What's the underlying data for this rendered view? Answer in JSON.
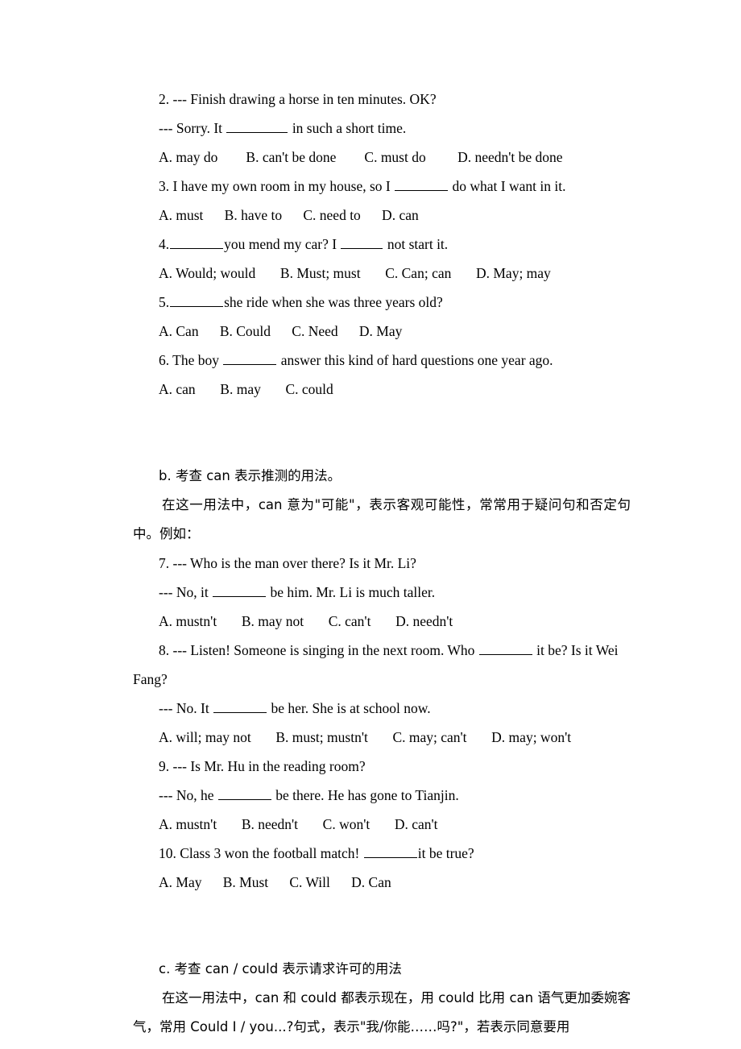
{
  "document": {
    "title": "Modal Verbs Grammar Exercises",
    "blocks": [
      {
        "id": "q2-stem1",
        "kind": "question-stem",
        "indent": true,
        "segments": [
          {
            "type": "text",
            "value": "2. --- Finish drawing a horse in ten minutes. OK?"
          }
        ]
      },
      {
        "id": "q2-stem2",
        "kind": "question-stem",
        "indent": true,
        "segments": [
          {
            "type": "text",
            "value": "--- Sorry. It "
          },
          {
            "type": "blank",
            "width": "w-lg"
          },
          {
            "type": "text",
            "value": " in such a short time."
          }
        ]
      },
      {
        "id": "q2-options",
        "kind": "options",
        "indent": true,
        "segments": [
          {
            "type": "text",
            "value": "A. may do        B. can't be done        C. must do         D. needn't be done"
          }
        ]
      },
      {
        "id": "q3-stem",
        "kind": "question-stem",
        "indent": true,
        "segments": [
          {
            "type": "text",
            "value": "3. I have my own room in my house, so I "
          },
          {
            "type": "blank",
            "width": "w-md"
          },
          {
            "type": "text",
            "value": " do what I want in it."
          }
        ]
      },
      {
        "id": "q3-options",
        "kind": "options",
        "indent": true,
        "segments": [
          {
            "type": "text",
            "value": "A. must      B. have to      C. need to      D. can"
          }
        ]
      },
      {
        "id": "q4-stem",
        "kind": "question-stem",
        "indent": true,
        "segments": [
          {
            "type": "text",
            "value": "4."
          },
          {
            "type": "blank",
            "width": "w-md"
          },
          {
            "type": "text",
            "value": "you mend my car? I "
          },
          {
            "type": "blank",
            "width": "w-sm"
          },
          {
            "type": "text",
            "value": " not start it."
          }
        ]
      },
      {
        "id": "q4-options",
        "kind": "options",
        "indent": true,
        "segments": [
          {
            "type": "text",
            "value": "A. Would; would       B. Must; must       C. Can; can       D. May; may"
          }
        ]
      },
      {
        "id": "q5-stem",
        "kind": "question-stem",
        "indent": true,
        "segments": [
          {
            "type": "text",
            "value": "5."
          },
          {
            "type": "blank",
            "width": "w-md"
          },
          {
            "type": "text",
            "value": "she ride when she was three years old?"
          }
        ]
      },
      {
        "id": "q5-options",
        "kind": "options",
        "indent": true,
        "segments": [
          {
            "type": "text",
            "value": "A. Can      B. Could      C. Need      D. May"
          }
        ]
      },
      {
        "id": "q6-stem",
        "kind": "question-stem",
        "indent": true,
        "segments": [
          {
            "type": "text",
            "value": "6. The boy "
          },
          {
            "type": "blank",
            "width": "w-md"
          },
          {
            "type": "text",
            "value": " answer this kind of hard questions one year ago."
          }
        ]
      },
      {
        "id": "q6-options",
        "kind": "options",
        "indent": true,
        "segments": [
          {
            "type": "text",
            "value": "A. can       B. may       C. could"
          }
        ]
      },
      {
        "id": "gap-1",
        "kind": "spacer"
      },
      {
        "id": "gap-2",
        "kind": "spacer"
      },
      {
        "id": "heading-b",
        "kind": "heading",
        "indent": true,
        "chinese": true,
        "segments": [
          {
            "type": "text",
            "value": "b. 考查 can 表示推测的用法。"
          }
        ]
      },
      {
        "id": "para-b",
        "kind": "paragraph",
        "chinese": true,
        "segments": [
          {
            "type": "text",
            "value": "在这一用法中，can 意为\"可能\"，表示客观可能性，常常用于疑问句和否定句中。例如："
          }
        ]
      },
      {
        "id": "q7-stem1",
        "kind": "question-stem",
        "indent": true,
        "segments": [
          {
            "type": "text",
            "value": "7. --- Who is the man over there? Is it Mr. Li?"
          }
        ]
      },
      {
        "id": "q7-stem2",
        "kind": "question-stem",
        "indent": true,
        "segments": [
          {
            "type": "text",
            "value": "--- No, it "
          },
          {
            "type": "blank",
            "width": "w-md"
          },
          {
            "type": "text",
            "value": " be him. Mr. Li is much taller."
          }
        ]
      },
      {
        "id": "q7-options",
        "kind": "options",
        "indent": true,
        "segments": [
          {
            "type": "text",
            "value": "A. mustn't       B. may not       C. can't       D. needn't"
          }
        ]
      },
      {
        "id": "q8-stem1",
        "kind": "question-stem",
        "indent": true,
        "segments": [
          {
            "type": "text",
            "value": "8. --- Listen! Someone is singing in the next room. Who "
          },
          {
            "type": "blank",
            "width": "w-md"
          },
          {
            "type": "text",
            "value": " it be? Is it Wei Fang?"
          }
        ]
      },
      {
        "id": "q8-stem2",
        "kind": "question-stem",
        "indent": true,
        "segments": [
          {
            "type": "text",
            "value": "--- No. It "
          },
          {
            "type": "blank",
            "width": "w-md"
          },
          {
            "type": "text",
            "value": " be her. She is at school now."
          }
        ]
      },
      {
        "id": "q8-options",
        "kind": "options",
        "indent": true,
        "segments": [
          {
            "type": "text",
            "value": "A. will; may not       B. must; mustn't       C. may; can't       D. may; won't"
          }
        ]
      },
      {
        "id": "q9-stem1",
        "kind": "question-stem",
        "indent": true,
        "segments": [
          {
            "type": "text",
            "value": "9. --- Is Mr. Hu in the reading room?"
          }
        ]
      },
      {
        "id": "q9-stem2",
        "kind": "question-stem",
        "indent": true,
        "segments": [
          {
            "type": "text",
            "value": "--- No, he "
          },
          {
            "type": "blank",
            "width": "w-md"
          },
          {
            "type": "text",
            "value": " be there. He has gone to Tianjin."
          }
        ]
      },
      {
        "id": "q9-options",
        "kind": "options",
        "indent": true,
        "segments": [
          {
            "type": "text",
            "value": "A. mustn't       B. needn't       C. won't       D. can't"
          }
        ]
      },
      {
        "id": "q10-stem",
        "kind": "question-stem",
        "indent": true,
        "segments": [
          {
            "type": "text",
            "value": "10. Class 3 won the football match! "
          },
          {
            "type": "blank",
            "width": "w-md"
          },
          {
            "type": "text",
            "value": "it be true?"
          }
        ]
      },
      {
        "id": "q10-options",
        "kind": "options",
        "indent": true,
        "segments": [
          {
            "type": "text",
            "value": "A. May      B. Must      C. Will      D. Can"
          }
        ]
      },
      {
        "id": "gap-3",
        "kind": "spacer"
      },
      {
        "id": "gap-4",
        "kind": "spacer"
      },
      {
        "id": "heading-c",
        "kind": "heading",
        "indent": true,
        "chinese": true,
        "segments": [
          {
            "type": "text",
            "value": "c. 考查 can / could 表示请求许可的用法"
          }
        ]
      },
      {
        "id": "para-c",
        "kind": "paragraph",
        "chinese": true,
        "segments": [
          {
            "type": "text",
            "value": "在这一用法中，can 和 could 都表示现在，用 could 比用 can 语气更加委婉客气，常用 Could I / you...?句式，表示\"我/你能……吗?\"，若表示同意要用"
          }
        ]
      }
    ]
  }
}
